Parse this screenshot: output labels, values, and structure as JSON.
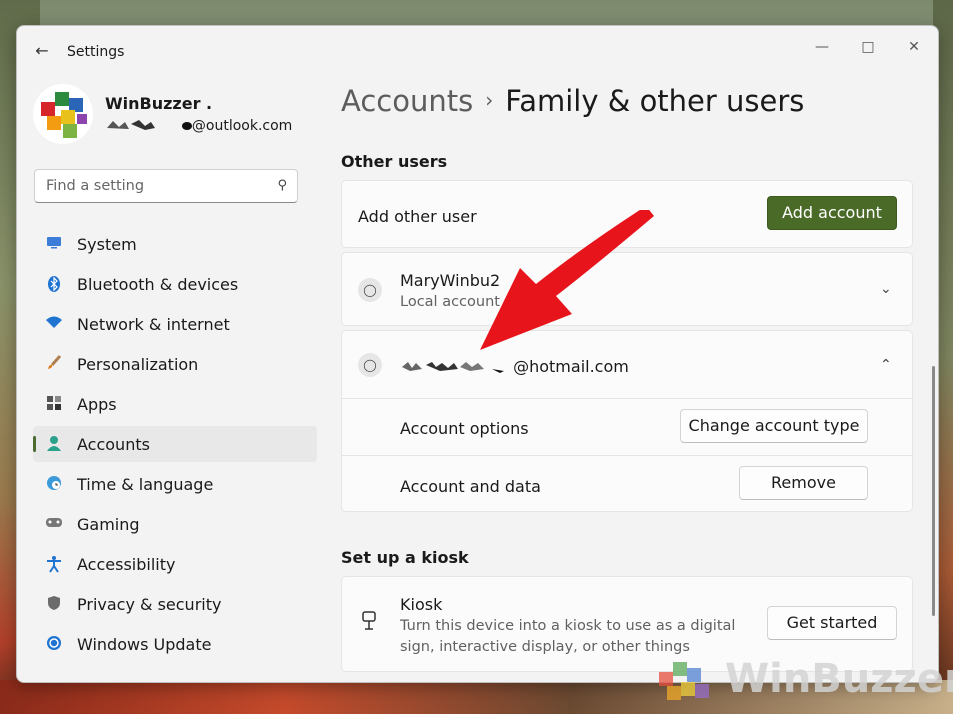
{
  "window": {
    "title": "Settings"
  },
  "profile": {
    "name": "WinBuzzer .",
    "email": "@outlook.com"
  },
  "search": {
    "placeholder": "Find a setting"
  },
  "sidebar": {
    "items": [
      {
        "label": "System",
        "icon": "monitor-icon"
      },
      {
        "label": "Bluetooth & devices",
        "icon": "bluetooth-icon"
      },
      {
        "label": "Network & internet",
        "icon": "wifi-icon"
      },
      {
        "label": "Personalization",
        "icon": "brush-icon"
      },
      {
        "label": "Apps",
        "icon": "apps-icon"
      },
      {
        "label": "Accounts",
        "icon": "person-icon",
        "active": true
      },
      {
        "label": "Time & language",
        "icon": "clock-globe-icon"
      },
      {
        "label": "Gaming",
        "icon": "gamepad-icon"
      },
      {
        "label": "Accessibility",
        "icon": "accessibility-icon"
      },
      {
        "label": "Privacy & security",
        "icon": "shield-icon"
      },
      {
        "label": "Windows Update",
        "icon": "update-icon"
      }
    ]
  },
  "header": {
    "parent": "Accounts",
    "separator": "›",
    "current": "Family & other users"
  },
  "other_users": {
    "title": "Other users",
    "add_label": "Add other user",
    "add_button": "Add account",
    "users": [
      {
        "name": "MaryWinbu2",
        "type": "Local account",
        "expanded": false
      },
      {
        "name": "@hotmail.com",
        "expanded": true
      }
    ],
    "account_options_label": "Account options",
    "change_type_button": "Change account type",
    "account_data_label": "Account and data",
    "remove_button": "Remove"
  },
  "kiosk": {
    "title": "Set up a kiosk",
    "name": "Kiosk",
    "description_line1": "Turn this device into a kiosk to use as a digital",
    "description_line2": "sign, interactive display, or other things",
    "button": "Get started"
  },
  "watermark": {
    "text": "WinBuzzer"
  },
  "colors": {
    "accent": "#4a6a27",
    "arrow": "#e8141b"
  }
}
